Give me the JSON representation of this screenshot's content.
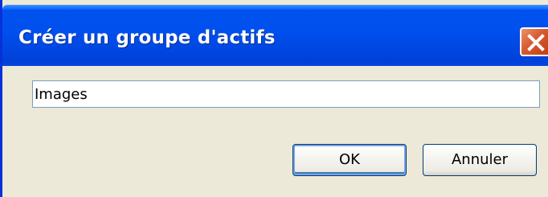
{
  "dialog": {
    "title": "Créer un groupe d'actifs",
    "close_icon": "close-icon",
    "accent_color": "#0054e3",
    "close_color": "#d6592f"
  },
  "form": {
    "group_name_value": "Images"
  },
  "buttons": {
    "ok_label": "OK",
    "cancel_label": "Annuler"
  }
}
